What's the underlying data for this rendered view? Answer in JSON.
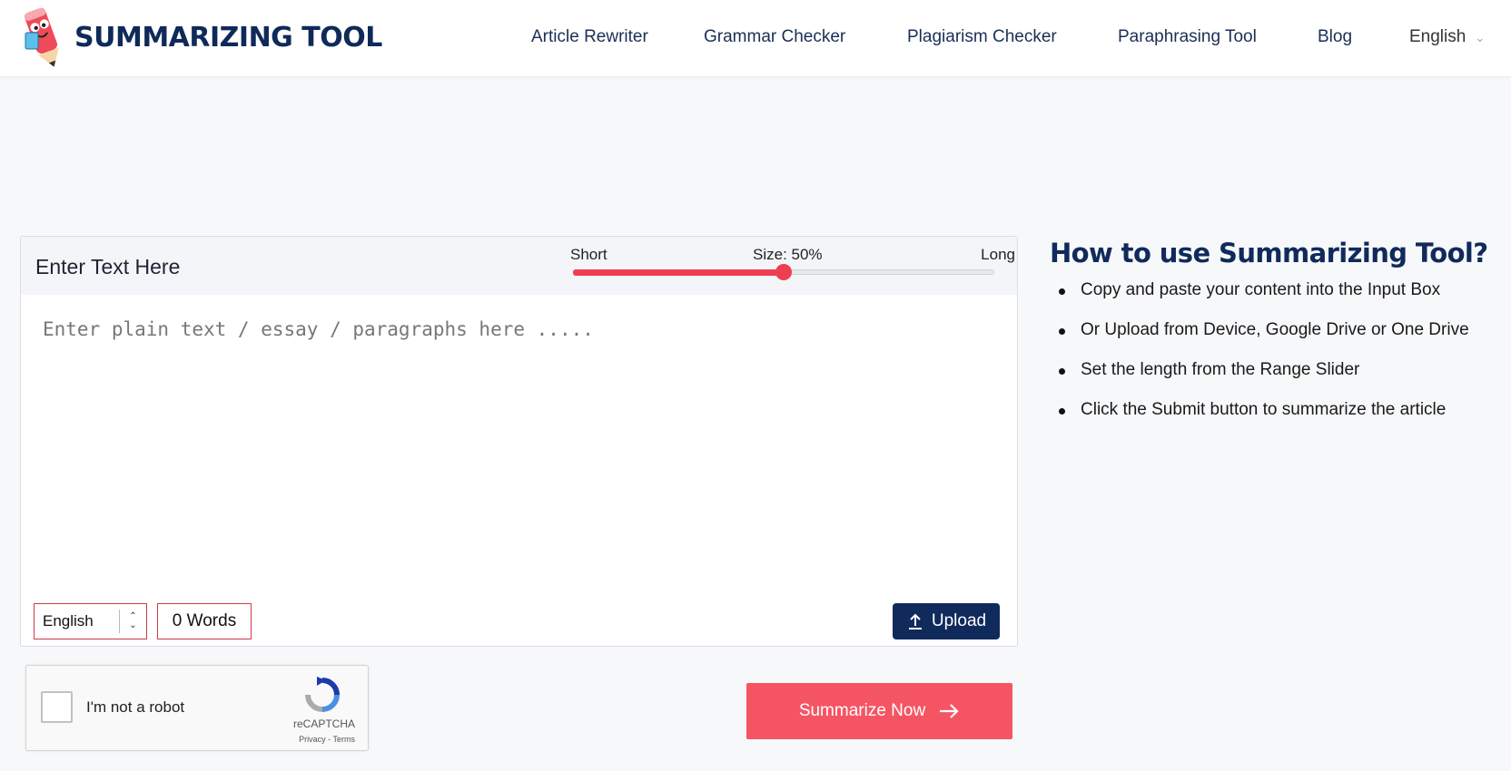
{
  "header": {
    "brand": "SUMMARIZING TOOL",
    "nav": [
      "Article Rewriter",
      "Grammar Checker",
      "Plagiarism Checker",
      "Paraphrasing Tool",
      "Blog"
    ],
    "language": "English"
  },
  "editor": {
    "title": "Enter Text Here",
    "slider": {
      "short_label": "Short",
      "size_label": "Size: 50%",
      "long_label": "Long",
      "value_percent": 50
    },
    "placeholder": "Enter plain text / essay / paragraphs here .....",
    "language": "English",
    "word_count": "0 Words",
    "upload_label": "Upload"
  },
  "captcha": {
    "label": "I'm not a robot",
    "brand": "reCAPTCHA",
    "links": "Privacy - Terms"
  },
  "submit_label": "Summarize Now",
  "howto": {
    "title": "How to use Summarizing Tool?",
    "steps": [
      "Copy and paste your content into the Input Box",
      "Or Upload from Device, Google Drive or One Drive",
      "Set the length from the Range Slider",
      "Click the Submit button to summarize the article"
    ]
  },
  "colors": {
    "brand_navy": "#102a5c",
    "accent_red": "#ee3f52",
    "button_red": "#f55563"
  }
}
